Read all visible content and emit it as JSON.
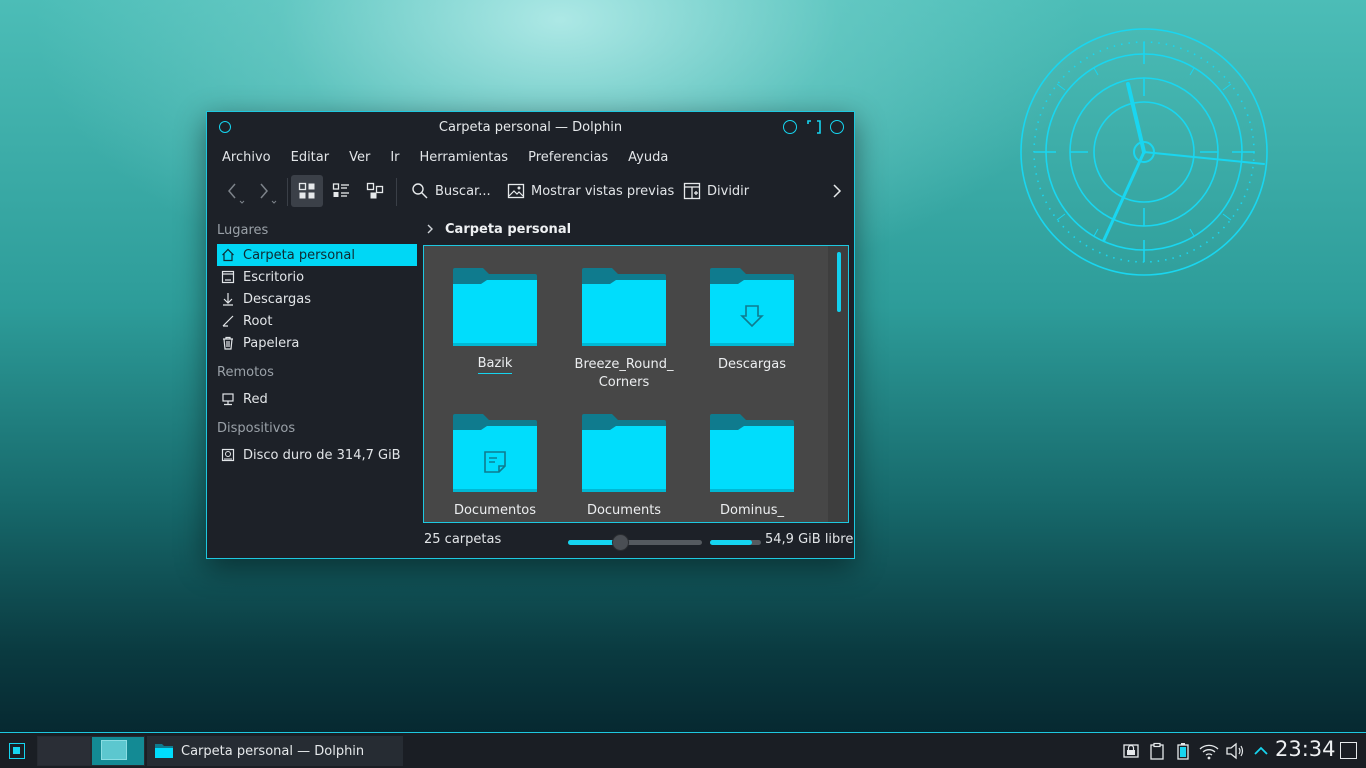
{
  "window": {
    "title": "Carpeta personal — Dolphin"
  },
  "menu": [
    "Archivo",
    "Editar",
    "Ver",
    "Ir",
    "Herramientas",
    "Preferencias",
    "Ayuda"
  ],
  "toolbar": {
    "back_icon": "go-back-icon",
    "forward_icon": "go-forward-icon",
    "view_icons": "view-icons-icon",
    "view_details": "view-details-icon",
    "view_tree": "view-tree-icon",
    "search_label": "Buscar...",
    "preview_label": "Mostrar vistas previas",
    "split_label": "Dividir"
  },
  "sidebar": {
    "places_header": "Lugares",
    "places": [
      {
        "label": "Carpeta personal",
        "icon": "home-icon",
        "selected": true
      },
      {
        "label": "Escritorio",
        "icon": "desktop-icon"
      },
      {
        "label": "Descargas",
        "icon": "download-icon"
      },
      {
        "label": "Root",
        "icon": "root-icon"
      },
      {
        "label": "Papelera",
        "icon": "trash-icon"
      }
    ],
    "remote_header": "Remotos",
    "remote": [
      {
        "label": "Red",
        "icon": "network-icon"
      }
    ],
    "devices_header": "Dispositivos",
    "devices": [
      {
        "label": "Disco duro de 314,7 GiB",
        "icon": "harddisk-icon"
      }
    ]
  },
  "breadcrumb": {
    "label": "Carpeta personal"
  },
  "files": [
    {
      "name": "Bazik",
      "emblem": "none"
    },
    {
      "name": "Breeze_Round_\nCorners",
      "emblem": "none"
    },
    {
      "name": "Descargas",
      "emblem": "download"
    },
    {
      "name": "Documentos",
      "emblem": "document"
    },
    {
      "name": "Documents",
      "emblem": "none"
    },
    {
      "name": "Dominus_",
      "emblem": "none"
    }
  ],
  "status": {
    "text": "25 carpetas",
    "zoom_fraction": 0.39,
    "free_space": "54,9 GiB libre",
    "used_fraction": 0.82
  },
  "taskbar": {
    "task_label": "Carpeta personal — Dolphin",
    "time": "23:34",
    "tray_icons": [
      "lock-screen-icon",
      "clipboard-icon",
      "battery-icon",
      "wifi-icon",
      "volume-icon",
      "tray-expand-icon"
    ]
  },
  "colors": {
    "accent": "#16d4ef",
    "window_bg": "#1d2128",
    "view_bg": "#474747",
    "folder_front": "#00ddfc",
    "folder_back": "#0f7b8e"
  }
}
